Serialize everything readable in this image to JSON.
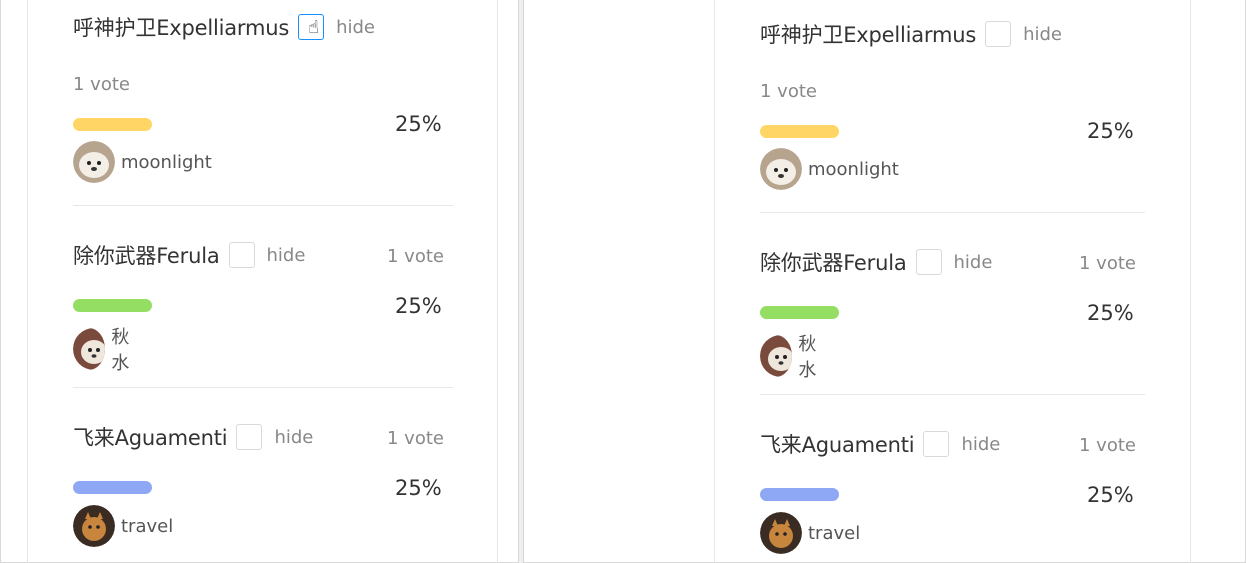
{
  "poll": {
    "hide_label": "hide",
    "options": [
      {
        "title": "呼神护卫Expelliarmus",
        "votes": "1 vote",
        "percent": "25%",
        "percent_value": 25,
        "bar_color": "#ffd666",
        "voter": "moonlight",
        "avatar_color": "#c7b9a8"
      },
      {
        "title": "除你武器Ferula",
        "votes": "1 vote",
        "percent": "25%",
        "percent_value": 25,
        "bar_color": "#95de64",
        "voter": "秋水",
        "avatar_color": "#8b5a4a"
      },
      {
        "title": "飞来Aguamenti",
        "votes": "1 vote",
        "percent": "25%",
        "percent_value": 25,
        "bar_color": "#8fa8f5",
        "voter": "travel",
        "avatar_color": "#b8803f"
      }
    ]
  }
}
